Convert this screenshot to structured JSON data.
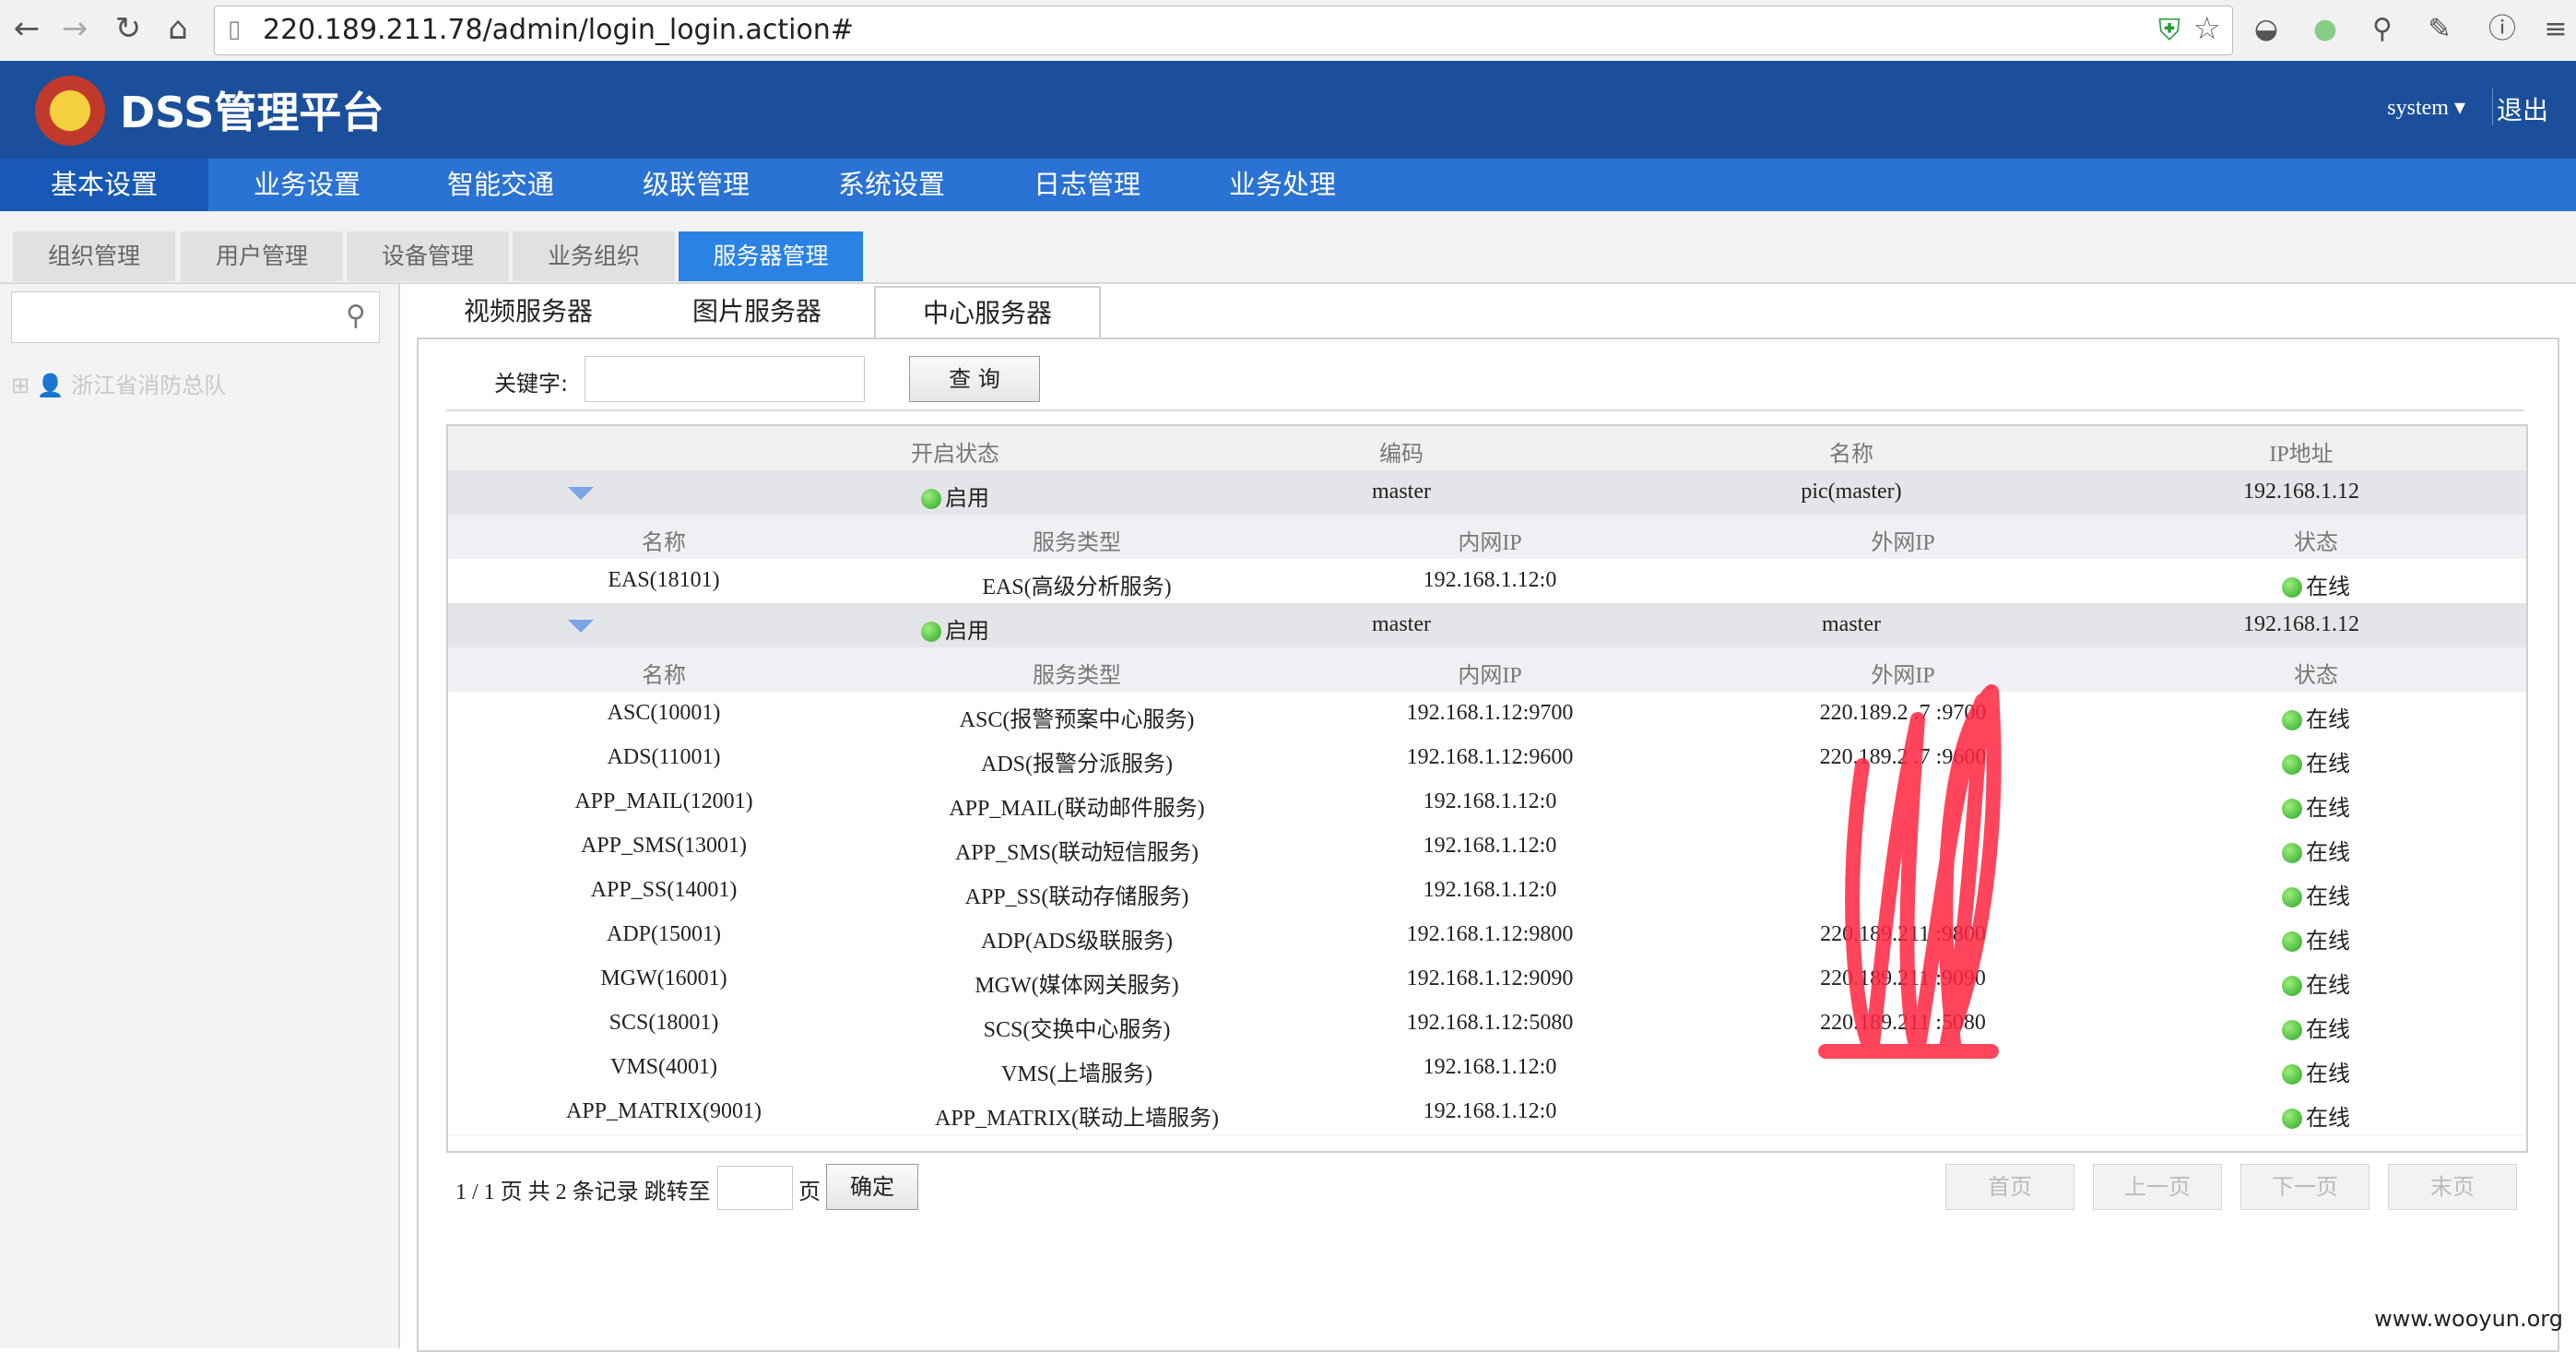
{
  "browser": {
    "url": "220.189.211.78/admin/login_login.action#"
  },
  "header": {
    "app_title": "DSS管理平台",
    "user": "system",
    "logout": "退出"
  },
  "main_nav": [
    "基本设置",
    "业务设置",
    "智能交通",
    "级联管理",
    "系统设置",
    "日志管理",
    "业务处理"
  ],
  "sub_nav": [
    "组织管理",
    "用户管理",
    "设备管理",
    "业务组织",
    "服务器管理"
  ],
  "left_panel": {
    "tree_root": "浙江省消防总队"
  },
  "content_tabs": [
    "视频服务器",
    "图片服务器",
    "中心服务器"
  ],
  "search": {
    "keyword_label": "关键字:",
    "query_button": "查 询"
  },
  "table": {
    "outer_headers": [
      "开启状态",
      "编码",
      "名称",
      "IP地址"
    ],
    "inner_headers": [
      "名称",
      "服务类型",
      "内网IP",
      "外网IP",
      "状态"
    ],
    "groups": [
      {
        "status": "启用",
        "code": "master",
        "name": "pic(master)",
        "ip": "192.168.1.12",
        "services": [
          {
            "name": "EAS(18101)",
            "type": "EAS(高级分析服务)",
            "lan_ip": "192.168.1.12:0",
            "wan_ip": "",
            "state": "在线"
          }
        ]
      },
      {
        "status": "启用",
        "code": "master",
        "name": "master",
        "ip": "192.168.1.12",
        "services": [
          {
            "name": "ASC(10001)",
            "type": "ASC(报警预案中心服务)",
            "lan_ip": "192.168.1.12:9700",
            "wan_ip": "220.189.2 .7 :9700",
            "state": "在线"
          },
          {
            "name": "ADS(11001)",
            "type": "ADS(报警分派服务)",
            "lan_ip": "192.168.1.12:9600",
            "wan_ip": "220.189.2 .7 :9600",
            "state": "在线"
          },
          {
            "name": "APP_MAIL(12001)",
            "type": "APP_MAIL(联动邮件服务)",
            "lan_ip": "192.168.1.12:0",
            "wan_ip": "",
            "state": "在线"
          },
          {
            "name": "APP_SMS(13001)",
            "type": "APP_SMS(联动短信服务)",
            "lan_ip": "192.168.1.12:0",
            "wan_ip": "",
            "state": "在线"
          },
          {
            "name": "APP_SS(14001)",
            "type": "APP_SS(联动存储服务)",
            "lan_ip": "192.168.1.12:0",
            "wan_ip": "",
            "state": "在线"
          },
          {
            "name": "ADP(15001)",
            "type": "ADP(ADS级联服务)",
            "lan_ip": "192.168.1.12:9800",
            "wan_ip": "220.189.211 :9800",
            "state": "在线"
          },
          {
            "name": "MGW(16001)",
            "type": "MGW(媒体网关服务)",
            "lan_ip": "192.168.1.12:9090",
            "wan_ip": "220.189.211 :9090",
            "state": "在线"
          },
          {
            "name": "SCS(18001)",
            "type": "SCS(交换中心服务)",
            "lan_ip": "192.168.1.12:5080",
            "wan_ip": "220.189.211 :5080",
            "state": "在线"
          },
          {
            "name": "VMS(4001)",
            "type": "VMS(上墙服务)",
            "lan_ip": "192.168.1.12:0",
            "wan_ip": "",
            "state": "在线"
          },
          {
            "name": "APP_MATRIX(9001)",
            "type": "APP_MATRIX(联动上墙服务)",
            "lan_ip": "192.168.1.12:0",
            "wan_ip": "",
            "state": "在线"
          }
        ]
      }
    ]
  },
  "pager": {
    "summary": "1 / 1 页 共 2 条记录 跳转至",
    "page_unit": "页",
    "confirm": "确定",
    "first": "首页",
    "prev": "上一页",
    "next": "下一页",
    "last": "末页"
  },
  "watermark": "www.wooyun.org"
}
